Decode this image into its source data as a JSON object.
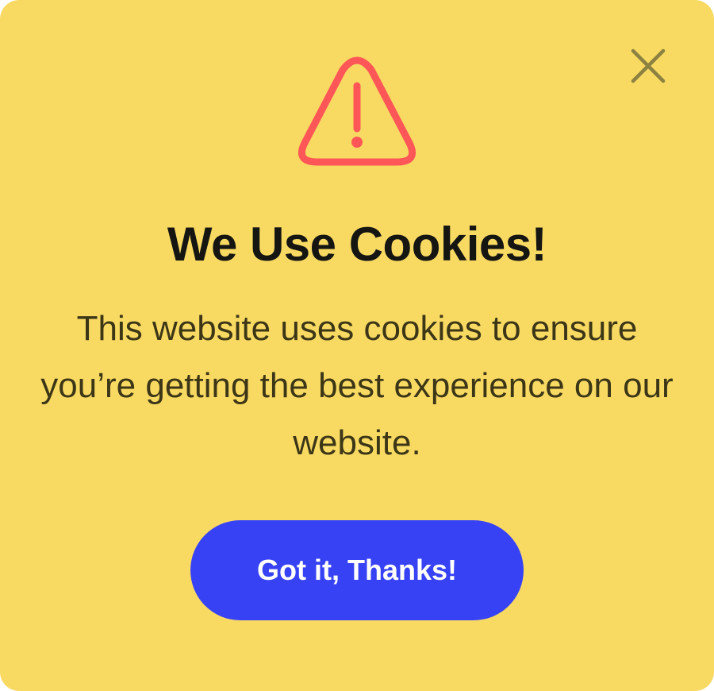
{
  "dialog": {
    "title": "We Use Cookies!",
    "message": "This website uses cookies to ensure you’re getting the best experience on our website.",
    "accept_label": "Got it, Thanks!",
    "icons": {
      "warning": "warning-triangle-icon",
      "close": "close-icon"
    }
  },
  "colors": {
    "background": "#F8DA63",
    "title": "#151511",
    "message": "#3C3617",
    "warning": "#FF5757",
    "close": "#8B8140",
    "button_bg": "#3742F5",
    "button_text": "#FFFFFF"
  }
}
